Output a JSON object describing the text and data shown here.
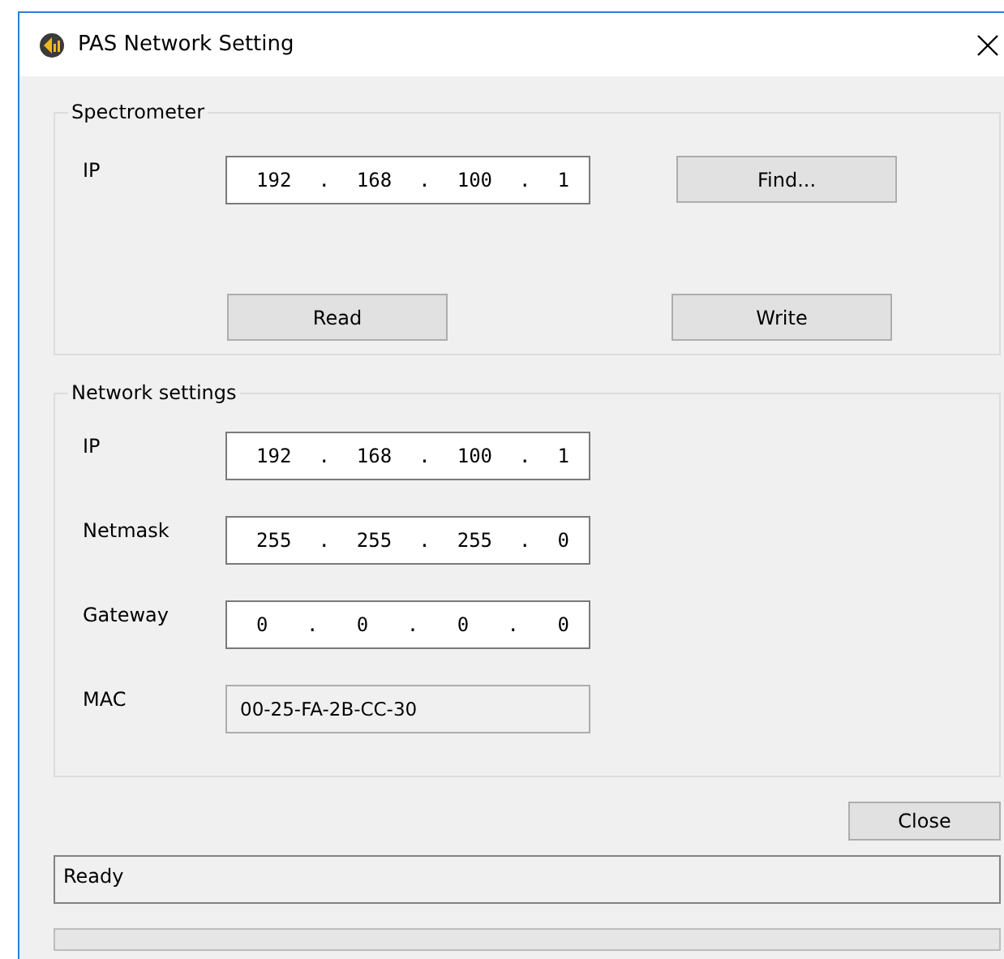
{
  "window": {
    "title": "PAS Network Setting"
  },
  "spectrometer": {
    "title": "Spectrometer",
    "ip": {
      "label": "IP",
      "parts": [
        "192",
        ".",
        "168",
        ".",
        "100",
        ".",
        "1"
      ],
      "disabled": false
    },
    "buttons": {
      "find": "Find...",
      "read": "Read",
      "write": "Write"
    }
  },
  "network_settings": {
    "title": "Network settings",
    "fields": [
      {
        "label": "IP",
        "kind": "address",
        "parts": [
          "192",
          ".",
          "168",
          ".",
          "100",
          ".",
          "1"
        ],
        "disabled": false
      },
      {
        "label": "Netmask",
        "kind": "address",
        "parts": [
          "255",
          ".",
          "255",
          ".",
          "255",
          ".",
          "0"
        ],
        "disabled": false
      },
      {
        "label": "Gateway",
        "kind": "address",
        "parts": [
          "0",
          ".",
          "0",
          ".",
          "0",
          ".",
          "0"
        ],
        "disabled": false
      },
      {
        "label": "MAC",
        "kind": "text",
        "value": "00-25-FA-2B-CC-30",
        "disabled": true
      }
    ]
  },
  "close_button": "Close",
  "status_bar": {
    "text": "Ready"
  },
  "progress": {
    "level": 0
  }
}
